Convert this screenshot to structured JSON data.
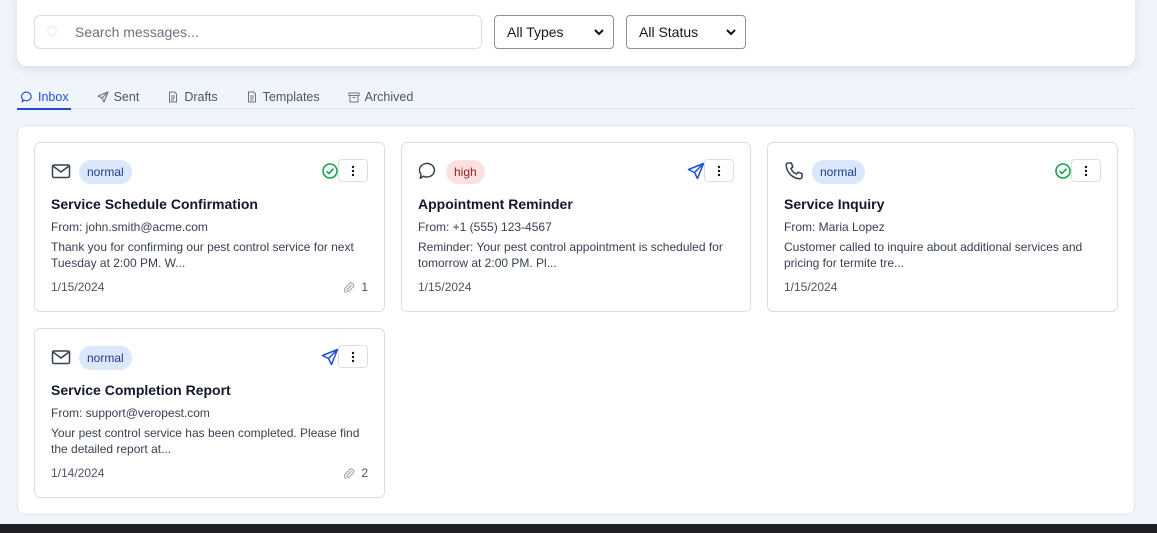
{
  "filters": {
    "search_placeholder": "Search messages...",
    "type_select": "All Types",
    "status_select": "All Status"
  },
  "tabs": [
    {
      "label": "Inbox",
      "icon": "chat-bubble-icon",
      "active": true
    },
    {
      "label": "Sent",
      "icon": "send-icon",
      "active": false
    },
    {
      "label": "Drafts",
      "icon": "document-icon",
      "active": false
    },
    {
      "label": "Templates",
      "icon": "document-icon",
      "active": false
    },
    {
      "label": "Archived",
      "icon": "archive-icon",
      "active": false
    }
  ],
  "messages": [
    {
      "type_icon": "mail-icon",
      "priority": "normal",
      "status_icon": "check-circle-icon",
      "title": "Service Schedule Confirmation",
      "from": "From: john.smith@acme.com",
      "preview": "Thank you for confirming our pest control service for next Tuesday at 2:00 PM. W...",
      "date": "1/15/2024",
      "attachments": "1"
    },
    {
      "type_icon": "chat-bubble-icon",
      "priority": "high",
      "status_icon": "send-icon",
      "title": "Appointment Reminder",
      "from": "From: +1 (555) 123-4567",
      "preview": "Reminder: Your pest control appointment is scheduled for tomorrow at 2:00 PM. Pl...",
      "date": "1/15/2024",
      "attachments": ""
    },
    {
      "type_icon": "phone-icon",
      "priority": "normal",
      "status_icon": "check-circle-icon",
      "title": "Service Inquiry",
      "from": "From: Maria Lopez",
      "preview": "Customer called to inquire about additional services and pricing for termite tre...",
      "date": "1/15/2024",
      "attachments": ""
    },
    {
      "type_icon": "mail-icon",
      "priority": "normal",
      "status_icon": "send-icon",
      "title": "Service Completion Report",
      "from": "From: support@veropest.com",
      "preview": "Your pest control service has been completed. Please find the detailed report at...",
      "date": "1/14/2024",
      "attachments": "2"
    }
  ],
  "colors": {
    "accent": "#1d4ed8",
    "success": "#16a34a",
    "normal_badge_bg": "#dbe7fb",
    "high_badge_bg": "#fde1e1"
  }
}
